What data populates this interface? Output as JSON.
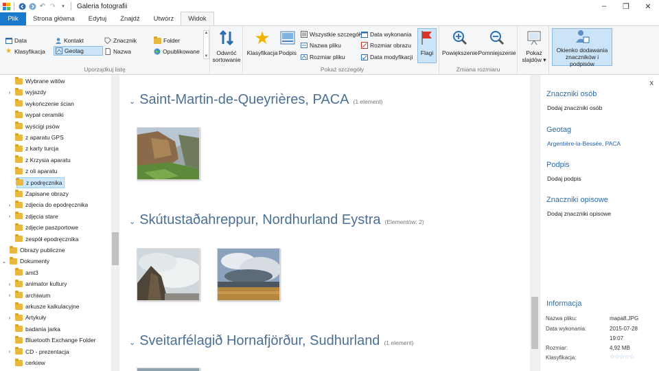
{
  "window": {
    "title": "Galeria fotografii",
    "controls": [
      "–",
      "❐",
      "✕"
    ]
  },
  "tabs": [
    "Plik",
    "Strona główna",
    "Edytuj",
    "Znajdź",
    "Utwórz",
    "Widok"
  ],
  "ribbon": {
    "arrange": {
      "label": "Uporządkuj listę",
      "items": [
        "Data",
        "Kontakt",
        "Znacznik",
        "Folder",
        "Klasyfikacja",
        "Geotag",
        "Nazwa",
        "Opublikowane"
      ],
      "reverse": [
        "Odwróć",
        "sortowanie"
      ]
    },
    "show": {
      "label": "Pokaż szczegóły",
      "klasyfikacja": "Klasyfikacja",
      "podpis": "Podpis",
      "items": [
        "Wszystkie szczegóły",
        "Nazwa pliku",
        "Rozmiar pliku",
        "Data wykonania",
        "Rozmiar obrazu",
        "Data modyfikacji"
      ],
      "flagi": "Flagi"
    },
    "resize": {
      "label": "Zmiana rozmiaru",
      "zoom_in": "Powiększenie",
      "zoom_out": "Pomniejszenie"
    },
    "slideshow": [
      "Pokaz",
      "slajdów ▾"
    ],
    "tag_pane": [
      "Okienko dodawania",
      "znaczników i podpisów"
    ]
  },
  "nav": {
    "items": [
      {
        "label": "Wybrane witów",
        "level": 2,
        "chev": ""
      },
      {
        "label": "wyjazdy",
        "level": 2,
        "chev": "›"
      },
      {
        "label": "wykończenie ścian",
        "level": 2,
        "chev": ""
      },
      {
        "label": "wypał ceramiki",
        "level": 2,
        "chev": ""
      },
      {
        "label": "wyścigi psów",
        "level": 2,
        "chev": ""
      },
      {
        "label": "z aparatu GPS",
        "level": 2,
        "chev": ""
      },
      {
        "label": "z karty turcja",
        "level": 2,
        "chev": ""
      },
      {
        "label": "z Krzysia aparatu",
        "level": 2,
        "chev": ""
      },
      {
        "label": "z oli aparatu",
        "level": 2,
        "chev": ""
      },
      {
        "label": "z podręcznika",
        "level": 2,
        "chev": "",
        "selected": true
      },
      {
        "label": "Zapisane obrazy",
        "level": 2,
        "chev": ""
      },
      {
        "label": "zdjecia do epodręcznika",
        "level": 2,
        "chev": "›"
      },
      {
        "label": "zdjęcia stare",
        "level": 2,
        "chev": "›"
      },
      {
        "label": "zdjęcie paszportowe",
        "level": 2,
        "chev": ""
      },
      {
        "label": "zespół epodręcznika",
        "level": 2,
        "chev": ""
      },
      {
        "label": "Obrazy publiczne",
        "level": 1,
        "chev": ""
      },
      {
        "label": "Dokumenty",
        "level": 1,
        "chev": "⌄"
      },
      {
        "label": "amt3",
        "level": 2,
        "chev": ""
      },
      {
        "label": "animator kultury",
        "level": 2,
        "chev": "›"
      },
      {
        "label": "archiwum",
        "level": 2,
        "chev": "›"
      },
      {
        "label": "arkusze kalkulacyjne",
        "level": 2,
        "chev": ""
      },
      {
        "label": "Artykuły",
        "level": 2,
        "chev": "›"
      },
      {
        "label": "badania jarka",
        "level": 2,
        "chev": ""
      },
      {
        "label": "Bluetooth Exchange Folder",
        "level": 2,
        "chev": ""
      },
      {
        "label": "CD - prezentacja",
        "level": 2,
        "chev": "›"
      },
      {
        "label": "cerkiew",
        "level": 2,
        "chev": ""
      }
    ]
  },
  "groups": [
    {
      "title": "Saint-Martin-de-Queyrières, PACA",
      "count": "(1 element)"
    },
    {
      "title": "Skútustaðahreppur, Nordhurland Eystra",
      "count": "(Elementów: 2)"
    },
    {
      "title": "Sveitarfélagið Hornafjörður, Sudhurland",
      "count": "(1 element)"
    }
  ],
  "info_pane": {
    "close": "x",
    "people_heading": "Znaczniki osób",
    "people_add": "Dodaj znaczniki osób",
    "geotag_heading": "Geotag",
    "geotag_value": "Argentière-la-Bessée, PACA",
    "caption_heading": "Podpis",
    "caption_add": "Dodaj podpis",
    "desc_heading": "Znaczniki opisowe",
    "desc_add": "Dodaj znaczniki opisowe",
    "info_heading": "Informacja",
    "fields": [
      {
        "label": "Nazwa pliku:",
        "value": "mapa8.JPG"
      },
      {
        "label": "Data wykonania:",
        "value": "2015-07-28"
      },
      {
        "label": "",
        "value": "19:07"
      },
      {
        "label": "Rozmiar:",
        "value": "4,92 MB"
      },
      {
        "label": "Klasyfikacja:",
        "value": ""
      }
    ],
    "rating": 0
  },
  "colors": {
    "accent": "#1979ca",
    "heading_blue": "#4c6f94",
    "link_blue": "#2d6ba8",
    "selection": "#cce8ff"
  }
}
